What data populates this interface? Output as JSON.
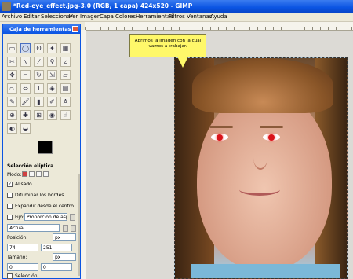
{
  "window": {
    "title": "*Red-eye_effect.jpg-3.0 (RGB, 1 capa) 424x520 - GIMP"
  },
  "menu": [
    "Archivo",
    "Editar",
    "Seleccionar",
    "Ver",
    "Imagen",
    "Capa",
    "Colores",
    "Herramientas",
    "Filtros",
    "Ventanas",
    "Ayuda"
  ],
  "callout": {
    "line1": "Abrimos la imagen con la cual",
    "line2": "vamos a trabajar."
  },
  "toolbox": {
    "title": "Caja de herramientas",
    "options_title": "Selección elíptica",
    "mode_label": "Modo:",
    "antialias_label": "Alisado",
    "feather_label": "Difuminar los bordes",
    "expand_label": "Expandir desde el centro",
    "fixed_label": "Fijo:",
    "fixed_value": "Proporción de aspecto",
    "current_value": "Actual",
    "position_label": "Posición:",
    "pos_x": "74",
    "pos_y": "251",
    "pos_unit": "px",
    "size_label": "Tamaño:",
    "size_w": "0",
    "size_h": "0",
    "size_unit": "px",
    "selection_label": "Selección"
  }
}
